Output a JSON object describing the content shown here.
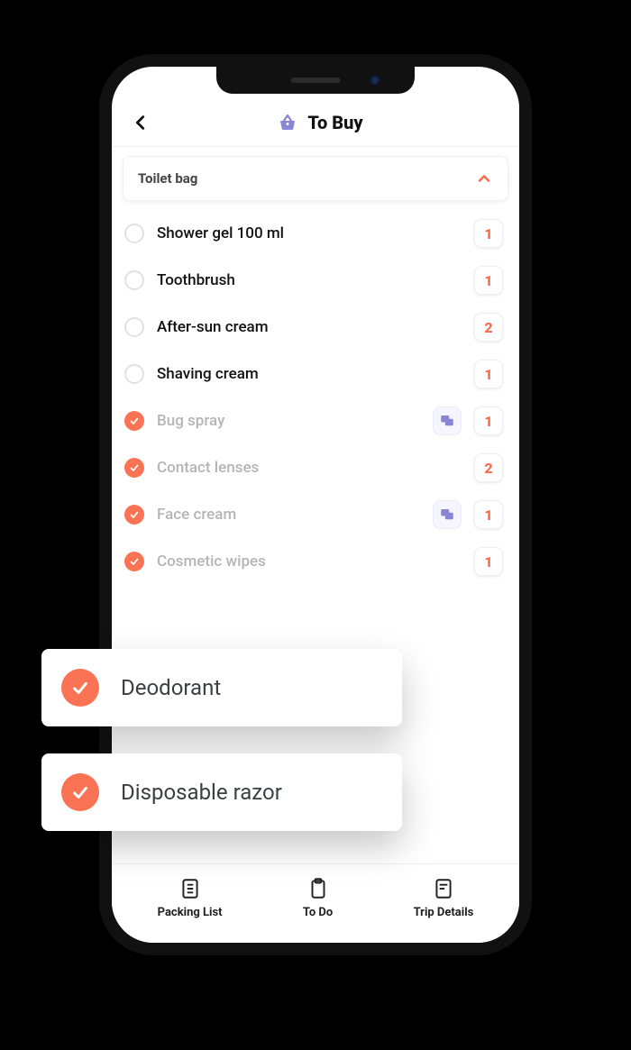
{
  "colors": {
    "accent": "#fa7354",
    "iconLavender": "#8a86d5"
  },
  "header": {
    "title": "To Buy"
  },
  "section": {
    "title": "Toilet bag"
  },
  "items": [
    {
      "label": "Shower gel 100 ml",
      "checked": false,
      "qty": "1",
      "hasNote": false
    },
    {
      "label": "Toothbrush",
      "checked": false,
      "qty": "1",
      "hasNote": false
    },
    {
      "label": "After-sun cream",
      "checked": false,
      "qty": "2",
      "hasNote": false
    },
    {
      "label": "Shaving cream",
      "checked": false,
      "qty": "1",
      "hasNote": false
    },
    {
      "label": "Bug spray",
      "checked": true,
      "qty": "1",
      "hasNote": true
    },
    {
      "label": "Contact lenses",
      "checked": true,
      "qty": "2",
      "hasNote": false
    },
    {
      "label": "Face cream",
      "checked": true,
      "qty": "1",
      "hasNote": true
    },
    {
      "label": "Cosmetic wipes",
      "checked": true,
      "qty": "1",
      "hasNote": false
    }
  ],
  "callouts": [
    {
      "label": "Deodorant"
    },
    {
      "label": "Disposable razor"
    }
  ],
  "tabs": [
    {
      "label": "Packing List"
    },
    {
      "label": "To Do"
    },
    {
      "label": "Trip Details"
    }
  ]
}
